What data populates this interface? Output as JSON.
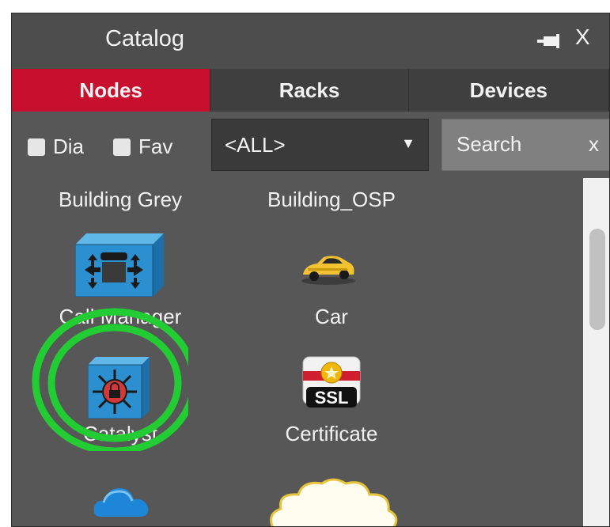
{
  "panel": {
    "title": "Catalog",
    "pin_icon": "pin-icon",
    "close_label": "X"
  },
  "tabs": [
    {
      "label": "Nodes",
      "active": true
    },
    {
      "label": "Racks",
      "active": false
    },
    {
      "label": "Devices",
      "active": false
    }
  ],
  "filters": {
    "dia_label": "Dia",
    "dia_checked": false,
    "fav_label": "Fav",
    "fav_checked": false,
    "type_select": "<ALL>",
    "search_placeholder": "Search",
    "search_clear": "x"
  },
  "catalog_items": [
    {
      "label": "Building Grey",
      "icon": "building-grey-icon"
    },
    {
      "label": "Building_OSP",
      "icon": "building-osp-icon"
    },
    {
      "label": "Call Manager",
      "icon": "call-manager-icon"
    },
    {
      "label": "Car",
      "icon": "car-icon"
    },
    {
      "label": "Catalyst",
      "icon": "catalyst-icon"
    },
    {
      "label": "Certificate",
      "icon": "ssl-certificate-icon"
    },
    {
      "label": "",
      "icon": "cloud-blue-icon"
    },
    {
      "label": "",
      "icon": "cloud-white-icon"
    }
  ],
  "colors": {
    "accent_tab": "#c8102e",
    "panel_bg": "#575757",
    "highlight_ring": "#22cc33"
  }
}
